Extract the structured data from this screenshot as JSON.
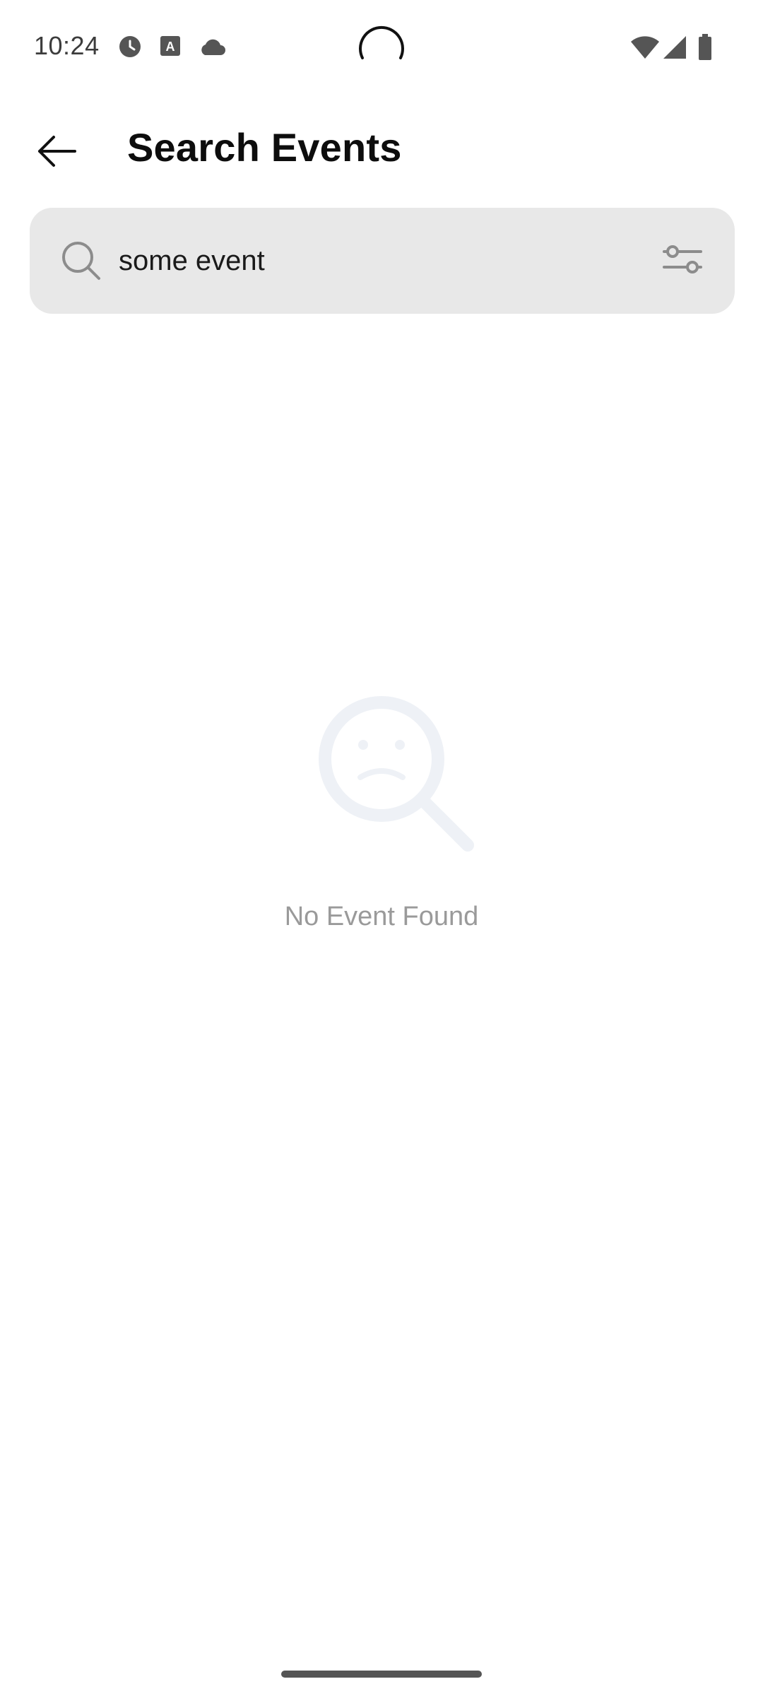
{
  "status_bar": {
    "time": "10:24",
    "icons": [
      "clock-icon",
      "font-app-icon",
      "cloud-icon",
      "wifi-icon",
      "cell-signal-icon",
      "battery-icon"
    ]
  },
  "header": {
    "title": "Search Events",
    "back_icon": "arrow-left-icon"
  },
  "search": {
    "value": "some event",
    "placeholder": "",
    "search_icon": "search-icon",
    "filter_icon": "sliders-icon"
  },
  "empty_state": {
    "icon": "sad-magnifier-icon",
    "message": "No Event Found"
  },
  "colors": {
    "background": "#ffffff",
    "search_bar_bg": "#e8e8e8",
    "title_text": "#0d0d0d",
    "muted_text": "#9a9a9a",
    "illustration": "#eef1f6"
  }
}
